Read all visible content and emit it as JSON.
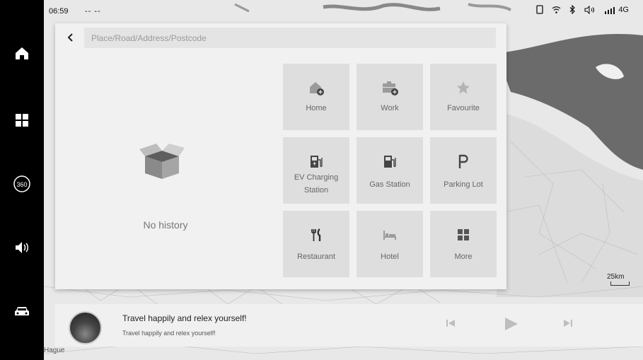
{
  "status_bar": {
    "time": "06:59",
    "placeholder_dashes": "-- --",
    "network": "4G"
  },
  "dock": {
    "items": [
      {
        "name": "home",
        "icon": "home-icon"
      },
      {
        "name": "apps",
        "icon": "grid-icon"
      },
      {
        "name": "360",
        "icon": "360-icon",
        "label": "360"
      },
      {
        "name": "volume",
        "icon": "speaker-icon"
      },
      {
        "name": "car",
        "icon": "car-icon"
      }
    ]
  },
  "search": {
    "placeholder": "Place/Road/Address/Postcode"
  },
  "history": {
    "empty_text": "No history"
  },
  "categories": [
    {
      "label": "Home",
      "icon": "home-add-icon"
    },
    {
      "label": "Work",
      "icon": "briefcase-add-icon"
    },
    {
      "label": "Favourite",
      "icon": "star-icon"
    },
    {
      "label": "EV Charging Station",
      "icon": "ev-charger-icon"
    },
    {
      "label": "Gas Station",
      "icon": "gas-pump-icon"
    },
    {
      "label": "Parking Lot",
      "icon": "parking-icon"
    },
    {
      "label": "Restaurant",
      "icon": "fork-knife-icon"
    },
    {
      "label": "Hotel",
      "icon": "bed-icon"
    },
    {
      "label": "More",
      "icon": "grid-icon"
    }
  ],
  "map": {
    "scale_label": "25km",
    "place_label": "Hague"
  },
  "media": {
    "title": "Travel happily and relex yourself!",
    "subtitle": "Travel happily and relex yourself!"
  }
}
